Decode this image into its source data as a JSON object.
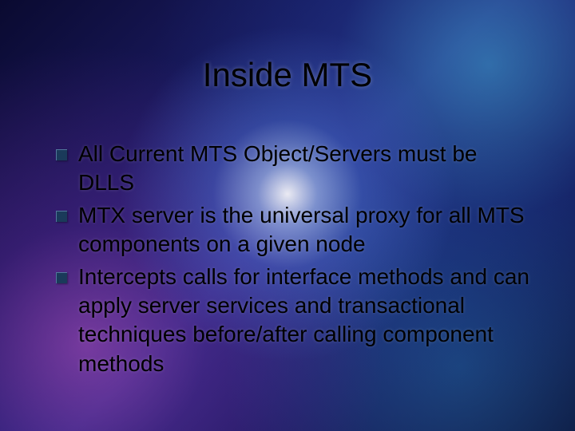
{
  "title": "Inside MTS",
  "bullets": [
    "All Current MTS Object/Servers must be DLLS",
    "MTX server is the universal proxy for all MTS components on a given node",
    "Intercepts calls for interface methods and can apply server services and transactional techniques before/after calling component methods"
  ]
}
